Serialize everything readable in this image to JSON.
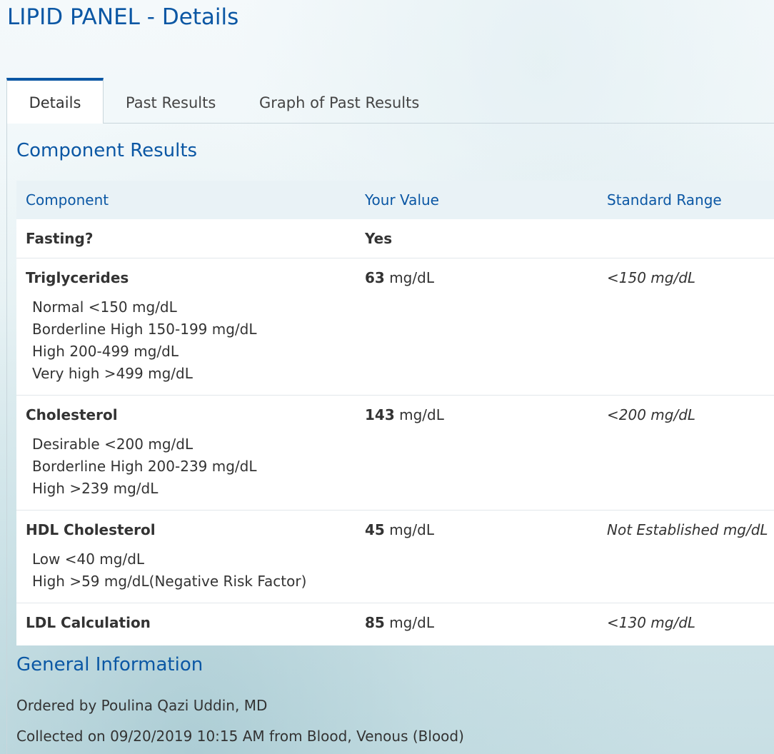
{
  "page": {
    "title": "LIPID PANEL - Details"
  },
  "tabs": [
    {
      "label": "Details",
      "active": true
    },
    {
      "label": "Past Results",
      "active": false
    },
    {
      "label": "Graph of Past Results",
      "active": false
    }
  ],
  "component_results": {
    "heading": "Component Results",
    "columns": {
      "component": "Component",
      "value": "Your Value",
      "range": "Standard Range"
    },
    "rows": [
      {
        "component": "Fasting?",
        "value": "Yes",
        "unit": "",
        "range": "",
        "ref_lines": []
      },
      {
        "component": "Triglycerides",
        "value": "63",
        "unit": " mg/dL",
        "range": "<150 mg/dL",
        "ref_lines": [
          "Normal <150 mg/dL",
          "Borderline High 150-199 mg/dL",
          "High 200-499 mg/dL",
          "Very high >499 mg/dL"
        ]
      },
      {
        "component": "Cholesterol",
        "value": "143",
        "unit": " mg/dL",
        "range": "<200 mg/dL",
        "ref_lines": [
          "Desirable <200 mg/dL",
          "Borderline High 200-239 mg/dL",
          "High >239 mg/dL"
        ]
      },
      {
        "component": "HDL Cholesterol",
        "value": "45",
        "unit": " mg/dL",
        "range": "Not Established mg/dL",
        "ref_lines": [
          "Low <40 mg/dL",
          "High >59 mg/dL(Negative Risk Factor)"
        ]
      },
      {
        "component": "LDL Calculation",
        "value": "85",
        "unit": " mg/dL",
        "range": "<130 mg/dL",
        "ref_lines": []
      }
    ]
  },
  "general_information": {
    "heading": "General Information",
    "ordered_by": "Ordered by Poulina Qazi Uddin, MD",
    "collected": "Collected on 09/20/2019 10:15 AM from Blood, Venous (Blood)"
  },
  "colors": {
    "accent": "#0b57a4",
    "header_row_bg": "#e9f2f6",
    "text": "#333333"
  }
}
